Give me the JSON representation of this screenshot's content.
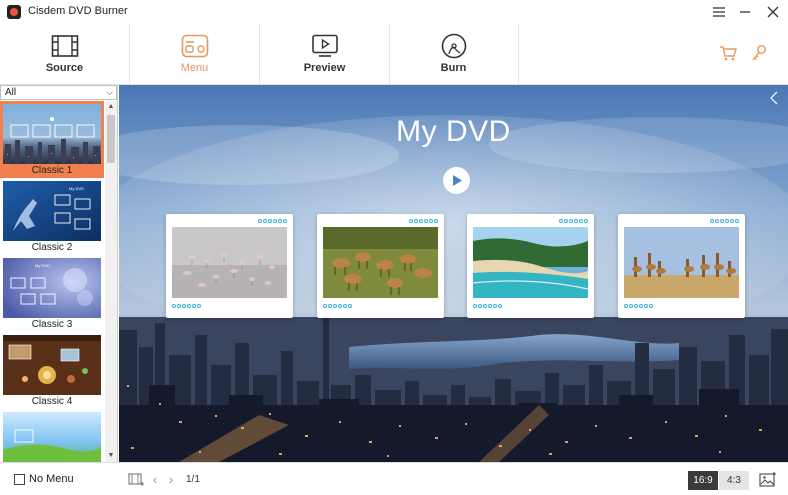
{
  "window": {
    "title": "Cisdem DVD Burner",
    "controls": [
      "menu-icon",
      "minimize-icon",
      "close-icon"
    ]
  },
  "toolbar": {
    "tabs": [
      {
        "label": "Source",
        "icon": "film-strip-icon",
        "active": false
      },
      {
        "label": "Menu",
        "icon": "menu-template-icon",
        "active": true
      },
      {
        "label": "Preview",
        "icon": "play-screen-icon",
        "active": false
      },
      {
        "label": "Burn",
        "icon": "disc-burn-icon",
        "active": false
      }
    ],
    "right_icons": [
      "cart-icon",
      "key-icon"
    ],
    "accent_color": "#e8985e"
  },
  "sidebar": {
    "filter": {
      "selected": "All"
    },
    "templates": [
      {
        "label": "Classic 1",
        "selected": true
      },
      {
        "label": "Classic 2",
        "selected": false
      },
      {
        "label": "Classic 3",
        "selected": false
      },
      {
        "label": "Classic 4",
        "selected": false
      },
      {
        "label": "",
        "selected": false
      }
    ],
    "thumb_text": "My DVD",
    "selected_color": "#f0804d"
  },
  "preview": {
    "menu_title": "My DVD",
    "play_icon": "play-circle-icon",
    "chapters": [
      {
        "subject": "flamingos on water"
      },
      {
        "subject": "antelope herd"
      },
      {
        "subject": "tropical beach"
      },
      {
        "subject": "giraffes on savanna"
      }
    ]
  },
  "bottombar": {
    "no_menu_label": "No Menu",
    "no_menu_checked": false,
    "page_indicator": "1/1",
    "ratio_options": [
      "16:9",
      "4:3"
    ],
    "ratio_selected": "16:9"
  }
}
